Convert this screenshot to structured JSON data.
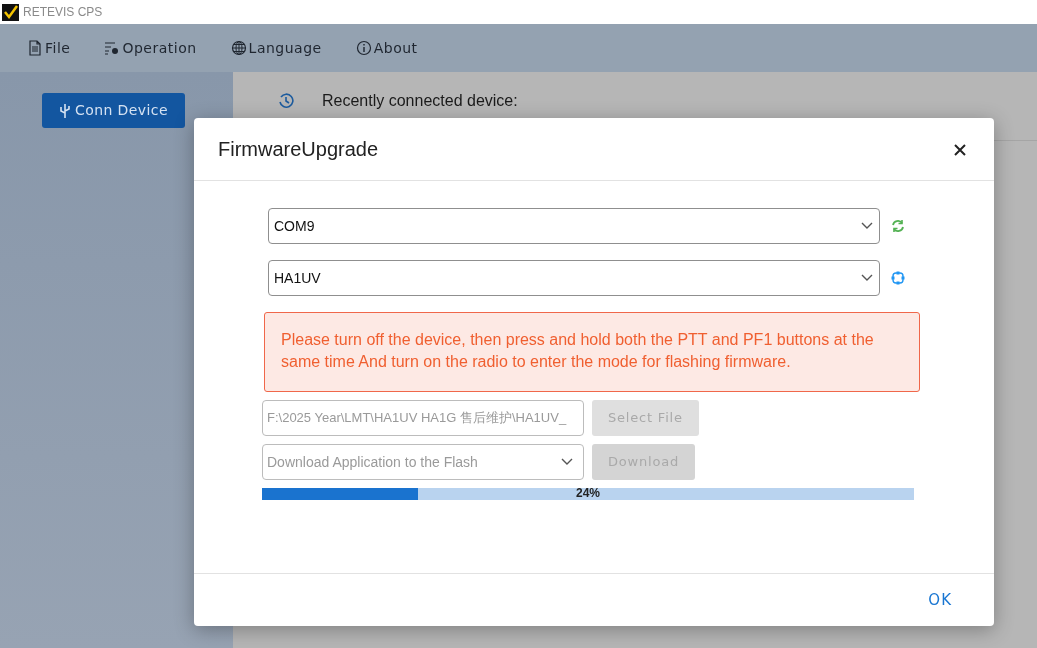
{
  "window": {
    "title": "RETEVIS CPS"
  },
  "menu": [
    {
      "label": "File"
    },
    {
      "label": "Operation"
    },
    {
      "label": "Language"
    },
    {
      "label": "About"
    }
  ],
  "sidebar": {
    "connect_button": "Conn Device"
  },
  "main": {
    "recent_label": "Recently connected device:"
  },
  "dialog": {
    "title": "FirmwareUpgrade",
    "port": {
      "value": "COM9"
    },
    "model": {
      "value": "HA1UV"
    },
    "notice": "Please turn off the device, then press and hold both the PTT and PF1 buttons at the same time And turn on the radio to enter the mode for flashing firmware.",
    "file_path": {
      "value": "F:\\2025 Year\\LMT\\HA1UV HA1G 售后维护\\HA1UV_",
      "disabled": true
    },
    "select_file_button": {
      "label": "Select File",
      "disabled": true
    },
    "mode": {
      "value": "Download Application to the Flash",
      "disabled": true
    },
    "download_button": {
      "label": "Download",
      "disabled": true
    },
    "progress": {
      "level": 0.24,
      "label": "24%"
    },
    "ok_button": "OK"
  }
}
